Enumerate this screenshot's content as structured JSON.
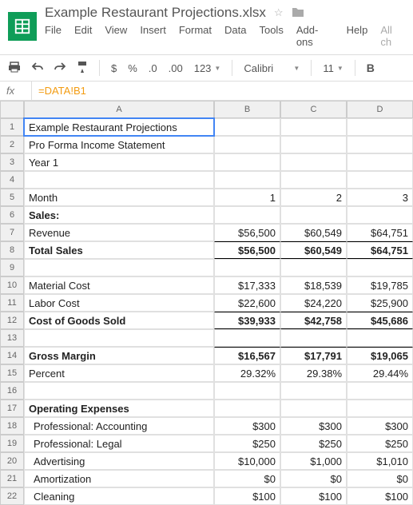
{
  "doc": {
    "title": "Example Restaurant Projections.xlsx"
  },
  "menu": {
    "file": "File",
    "edit": "Edit",
    "view": "View",
    "insert": "Insert",
    "format": "Format",
    "data": "Data",
    "tools": "Tools",
    "addons": "Add-ons",
    "help": "Help",
    "allch": "All ch"
  },
  "toolbar": {
    "dollar": "$",
    "percent": "%",
    "dec0": ".0",
    "dec00": ".00",
    "num123": "123",
    "font": "Calibri",
    "size": "11",
    "bold": "B"
  },
  "fx": {
    "label": "fx",
    "content": "=DATA!B1"
  },
  "cols": {
    "a": "A",
    "b": "B",
    "c": "C",
    "d": "D"
  },
  "rows": [
    {
      "n": "1",
      "a": "Example Restaurant Projections",
      "sel": true
    },
    {
      "n": "2",
      "a": "Pro Forma Income Statement"
    },
    {
      "n": "3",
      "a": "Year 1"
    },
    {
      "n": "4",
      "a": ""
    },
    {
      "n": "5",
      "a": "Month",
      "b": "1",
      "c": "2",
      "d": "3"
    },
    {
      "n": "6",
      "a": "Sales:",
      "bold": true
    },
    {
      "n": "7",
      "a": "Revenue",
      "b": "$56,500",
      "c": "$60,549",
      "d": "$64,751"
    },
    {
      "n": "8",
      "a": "Total Sales",
      "b": "$56,500",
      "c": "$60,549",
      "d": "$64,751",
      "bold": true,
      "btop": true,
      "bbot": true
    },
    {
      "n": "9",
      "a": ""
    },
    {
      "n": "10",
      "a": "Material Cost",
      "b": "$17,333",
      "c": "$18,539",
      "d": "$19,785"
    },
    {
      "n": "11",
      "a": "Labor Cost",
      "b": "$22,600",
      "c": "$24,220",
      "d": "$25,900"
    },
    {
      "n": "12",
      "a": "Cost of Goods Sold",
      "b": "$39,933",
      "c": "$42,758",
      "d": "$45,686",
      "bold": true,
      "btop": true,
      "bbot": true
    },
    {
      "n": "13",
      "a": ""
    },
    {
      "n": "14",
      "a": "Gross Margin",
      "b": "$16,567",
      "c": "$17,791",
      "d": "$19,065",
      "bold": true,
      "btop": true
    },
    {
      "n": "15",
      "a": "Percent",
      "b": "29.32%",
      "c": "29.38%",
      "d": "29.44%"
    },
    {
      "n": "16",
      "a": ""
    },
    {
      "n": "17",
      "a": "Operating Expenses",
      "bold": true
    },
    {
      "n": "18",
      "a": "Professional: Accounting",
      "b": "$300",
      "c": "$300",
      "d": "$300",
      "indent": true
    },
    {
      "n": "19",
      "a": "Professional: Legal",
      "b": "$250",
      "c": "$250",
      "d": "$250",
      "indent": true
    },
    {
      "n": "20",
      "a": "Advertising",
      "b": "$10,000",
      "c": "$1,000",
      "d": "$1,010",
      "indent": true
    },
    {
      "n": "21",
      "a": "Amortization",
      "b": "$0",
      "c": "$0",
      "d": "$0",
      "indent": true
    },
    {
      "n": "22",
      "a": "Cleaning",
      "b": "$100",
      "c": "$100",
      "d": "$100",
      "indent": true
    }
  ]
}
